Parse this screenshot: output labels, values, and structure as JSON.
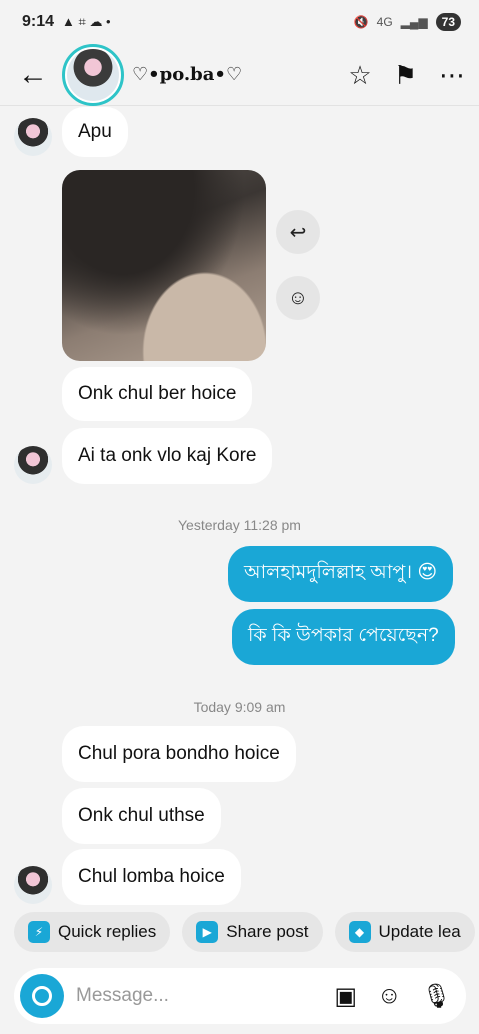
{
  "status": {
    "time": "9:14",
    "left_icons": "▲ ⌗ ☁ •",
    "network": "4G",
    "battery": "73"
  },
  "header": {
    "contact_name": "♡•po.ba•♡",
    "back_icon": "←",
    "star_icon": "☆",
    "flag_icon": "⚑",
    "more_icon": "⋯"
  },
  "messages": {
    "m1": "Apu",
    "m2": "Onk chul ber hoice",
    "m3": "Ai ta onk vlo kaj Kore",
    "ts1": "Yesterday 11:28 pm",
    "s1": "আলহামদুলিল্লাহ আপু। 😍",
    "s2": "কি কি উপকার পেয়েছেন?",
    "ts2": "Today 9:09 am",
    "m4": "Chul pora bondho hoice",
    "m5": "Onk chul uthse",
    "m6": "Chul lomba hoice"
  },
  "photo_actions": {
    "reply_icon": "↩",
    "react_icon": "☺"
  },
  "quick_bar": {
    "quick_replies": "Quick replies",
    "share_post": "Share post",
    "update_lead": "Update lea"
  },
  "composer": {
    "placeholder": "Message...",
    "gallery_icon": "▣",
    "sticker_icon": "☺",
    "mic_icon": "🎙"
  },
  "colors": {
    "accent": "#1aa7d6",
    "ring": "#2ec4c8",
    "background": "#f3f3f3"
  }
}
